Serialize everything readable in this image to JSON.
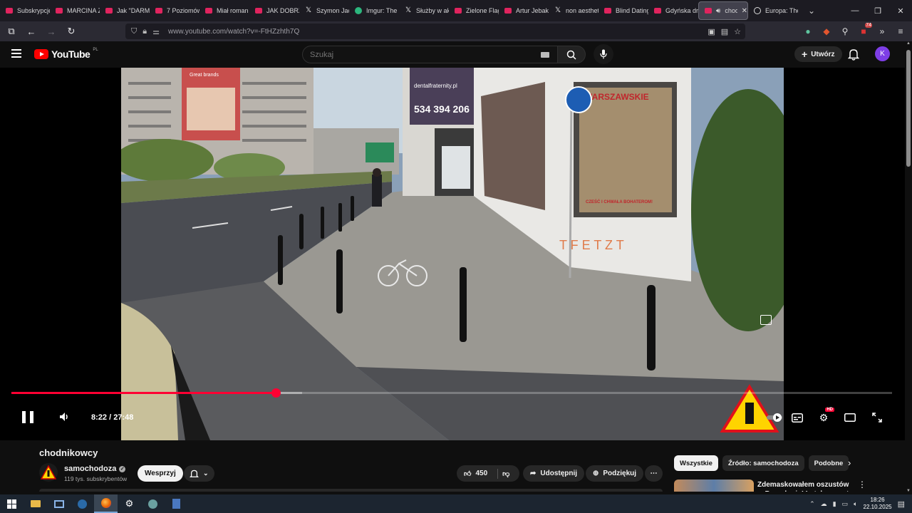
{
  "browser": {
    "tabs": [
      {
        "title": "Subskrypcje",
        "icon": "youtube-icon"
      },
      {
        "title": "MARCINA Z",
        "icon": "youtube-icon"
      },
      {
        "title": "Jak \"DARMO",
        "icon": "youtube-icon"
      },
      {
        "title": "7 Poziomów",
        "icon": "youtube-icon"
      },
      {
        "title": "Miał roman",
        "icon": "youtube-icon"
      },
      {
        "title": "JAK DOBRZ",
        "icon": "youtube-icon"
      },
      {
        "title": "Szymon Jac",
        "icon": "x-icon"
      },
      {
        "title": "Imgur: The",
        "icon": "imgur-icon"
      },
      {
        "title": "Służby w ak",
        "icon": "x-icon"
      },
      {
        "title": "Zielone Flag",
        "icon": "youtube-icon"
      },
      {
        "title": "Artur Jebak",
        "icon": "youtube-icon"
      },
      {
        "title": "non aesthet",
        "icon": "x-icon"
      },
      {
        "title": "Blind Dating",
        "icon": "youtube-icon"
      },
      {
        "title": "Gdyńska dr",
        "icon": "youtube-icon"
      },
      {
        "title": "chodn",
        "icon": "youtube-icon",
        "active": true
      },
      {
        "title": "Europa: The",
        "icon": "globe-icon"
      }
    ],
    "url": "www.youtube.com/watch?v=-FtHZzhth7Q",
    "extension_badge": "74"
  },
  "youtube": {
    "logo_text": "YouTube",
    "region": "PL",
    "search_placeholder": "Szukaj",
    "create_label": "Utwórz",
    "avatar_letter": "K"
  },
  "player": {
    "current_time": "8:22",
    "duration": "27:48",
    "time_display": "8:22 / 27:48",
    "progress_fraction": 0.3,
    "buffered_fraction": 0.33,
    "hd_badge": "HD"
  },
  "video_scene": {
    "sign_number": "534 394 206",
    "sign_web": "dentalfraternity.pl",
    "billboard_text": "Great brands",
    "poster_text": "WARSZAWSKIE",
    "poster_sub": "CZEŚĆ I CHWAŁA BOHATEROM!"
  },
  "video": {
    "title": "chodnikowcy",
    "channel": "samochodoza",
    "subscribers": "119 tys. subskrybentów",
    "support_label": "Wesprzyj",
    "likes": "450",
    "share_label": "Udostępnij",
    "thanks_label": "Podziękuj"
  },
  "sidebar": {
    "chips": [
      "Wszystkie",
      "Źródło: samochodoza",
      "Podobne"
    ],
    "rec_title": "Zdemaskowałem oszustów w Barcelonie! Łatakowanyt"
  },
  "taskbar": {
    "time": "18:26",
    "date": "22.10.2025"
  },
  "colors": {
    "yt_red": "#ff0000",
    "progress_red": "#ff0033",
    "avatar_purple": "#7e3ee6"
  }
}
